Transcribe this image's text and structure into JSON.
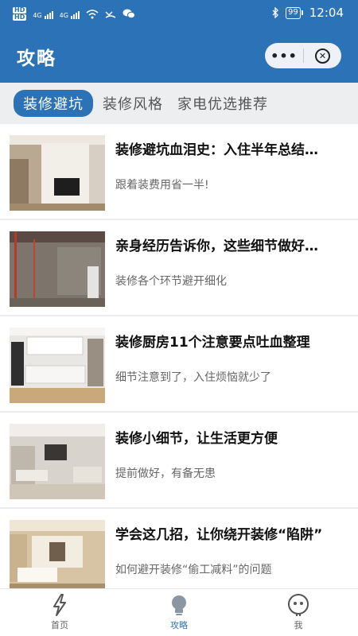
{
  "status_bar": {
    "hd1": "HD",
    "hd2": "HD",
    "net1": "4G",
    "net2": "4G",
    "battery": "99",
    "time": "12:04"
  },
  "header": {
    "title": "攻略",
    "capsule_more": "•••"
  },
  "tabs": [
    {
      "label": "装修避坑",
      "active": true
    },
    {
      "label": "装修风格",
      "active": false
    },
    {
      "label": "家电优选推荐",
      "active": false
    }
  ],
  "articles": [
    {
      "title": "装修避坑血泪史：入住半年总结…",
      "subtitle": "跟着装费用省一半!"
    },
    {
      "title": "亲身经历告诉你，这些细节做好…",
      "subtitle": "装修各个环节避开细化"
    },
    {
      "title": "装修厨房11个注意要点吐血整理",
      "subtitle": "细节注意到了，入住烦恼就少了"
    },
    {
      "title": "装修小细节，让生活更方便",
      "subtitle": "提前做好，有备无患"
    },
    {
      "title": "学会这几招，让你绕开装修“陷阱”",
      "subtitle": "如何避开装修“偷工减料”的问题"
    }
  ],
  "bottom_nav": [
    {
      "label": "首页",
      "icon": "lightning-icon",
      "active": false
    },
    {
      "label": "攻略",
      "icon": "lightbulb-icon",
      "active": true
    },
    {
      "label": "我",
      "icon": "face-icon",
      "active": false
    }
  ],
  "colors": {
    "primary": "#2b73b6",
    "tab_bg": "#eceef0",
    "title_text": "#111111",
    "subtitle_text": "#666666"
  }
}
